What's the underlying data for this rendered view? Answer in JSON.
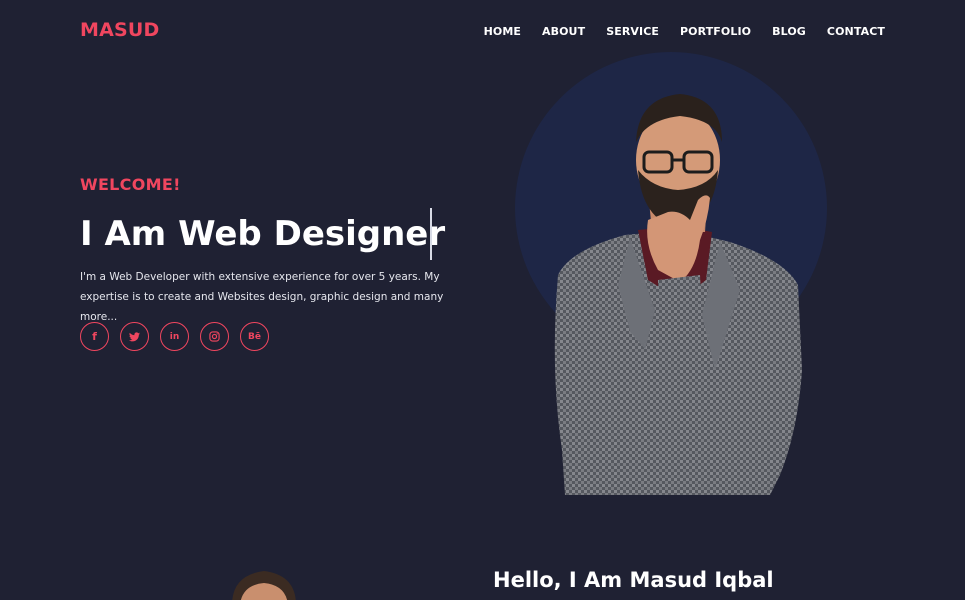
{
  "brand": {
    "logo_text": "MASUD",
    "accent_color": "#f0465f",
    "background_color": "#1f2133"
  },
  "nav": {
    "items": [
      "HOME",
      "ABOUT",
      "SERVICE",
      "PORTFOLIO",
      "BLOG",
      "CONTACT"
    ]
  },
  "hero": {
    "welcome": "WELCOME!",
    "headline": "I Am Web Designer",
    "intro": "I'm a Web Developer with extensive experience for over 5 years. My expertise is to create and Websites design, graphic design and many more...",
    "image_alt": "portrait of a bearded man with glasses in a checkered blazer"
  },
  "socials": [
    {
      "name": "facebook-icon",
      "glyph": "f"
    },
    {
      "name": "twitter-icon",
      "glyph": ""
    },
    {
      "name": "linkedin-icon",
      "glyph": "in"
    },
    {
      "name": "instagram-icon",
      "glyph": ""
    },
    {
      "name": "behance-icon",
      "glyph": "Bē"
    }
  ],
  "about": {
    "title": "Hello, I Am Masud Iqbal"
  }
}
